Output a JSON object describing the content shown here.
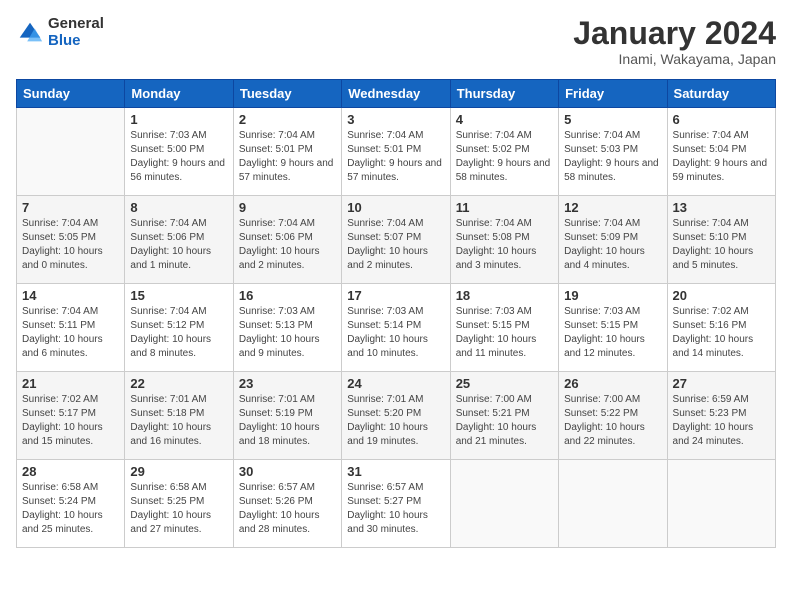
{
  "logo": {
    "general": "General",
    "blue": "Blue"
  },
  "title": "January 2024",
  "subtitle": "Inami, Wakayama, Japan",
  "headers": [
    "Sunday",
    "Monday",
    "Tuesday",
    "Wednesday",
    "Thursday",
    "Friday",
    "Saturday"
  ],
  "weeks": [
    [
      {
        "day": "",
        "sunrise": "",
        "sunset": "",
        "daylight": ""
      },
      {
        "day": "1",
        "sunrise": "Sunrise: 7:03 AM",
        "sunset": "Sunset: 5:00 PM",
        "daylight": "Daylight: 9 hours and 56 minutes."
      },
      {
        "day": "2",
        "sunrise": "Sunrise: 7:04 AM",
        "sunset": "Sunset: 5:01 PM",
        "daylight": "Daylight: 9 hours and 57 minutes."
      },
      {
        "day": "3",
        "sunrise": "Sunrise: 7:04 AM",
        "sunset": "Sunset: 5:01 PM",
        "daylight": "Daylight: 9 hours and 57 minutes."
      },
      {
        "day": "4",
        "sunrise": "Sunrise: 7:04 AM",
        "sunset": "Sunset: 5:02 PM",
        "daylight": "Daylight: 9 hours and 58 minutes."
      },
      {
        "day": "5",
        "sunrise": "Sunrise: 7:04 AM",
        "sunset": "Sunset: 5:03 PM",
        "daylight": "Daylight: 9 hours and 58 minutes."
      },
      {
        "day": "6",
        "sunrise": "Sunrise: 7:04 AM",
        "sunset": "Sunset: 5:04 PM",
        "daylight": "Daylight: 9 hours and 59 minutes."
      }
    ],
    [
      {
        "day": "7",
        "sunrise": "Sunrise: 7:04 AM",
        "sunset": "Sunset: 5:05 PM",
        "daylight": "Daylight: 10 hours and 0 minutes."
      },
      {
        "day": "8",
        "sunrise": "Sunrise: 7:04 AM",
        "sunset": "Sunset: 5:06 PM",
        "daylight": "Daylight: 10 hours and 1 minute."
      },
      {
        "day": "9",
        "sunrise": "Sunrise: 7:04 AM",
        "sunset": "Sunset: 5:06 PM",
        "daylight": "Daylight: 10 hours and 2 minutes."
      },
      {
        "day": "10",
        "sunrise": "Sunrise: 7:04 AM",
        "sunset": "Sunset: 5:07 PM",
        "daylight": "Daylight: 10 hours and 2 minutes."
      },
      {
        "day": "11",
        "sunrise": "Sunrise: 7:04 AM",
        "sunset": "Sunset: 5:08 PM",
        "daylight": "Daylight: 10 hours and 3 minutes."
      },
      {
        "day": "12",
        "sunrise": "Sunrise: 7:04 AM",
        "sunset": "Sunset: 5:09 PM",
        "daylight": "Daylight: 10 hours and 4 minutes."
      },
      {
        "day": "13",
        "sunrise": "Sunrise: 7:04 AM",
        "sunset": "Sunset: 5:10 PM",
        "daylight": "Daylight: 10 hours and 5 minutes."
      }
    ],
    [
      {
        "day": "14",
        "sunrise": "Sunrise: 7:04 AM",
        "sunset": "Sunset: 5:11 PM",
        "daylight": "Daylight: 10 hours and 6 minutes."
      },
      {
        "day": "15",
        "sunrise": "Sunrise: 7:04 AM",
        "sunset": "Sunset: 5:12 PM",
        "daylight": "Daylight: 10 hours and 8 minutes."
      },
      {
        "day": "16",
        "sunrise": "Sunrise: 7:03 AM",
        "sunset": "Sunset: 5:13 PM",
        "daylight": "Daylight: 10 hours and 9 minutes."
      },
      {
        "day": "17",
        "sunrise": "Sunrise: 7:03 AM",
        "sunset": "Sunset: 5:14 PM",
        "daylight": "Daylight: 10 hours and 10 minutes."
      },
      {
        "day": "18",
        "sunrise": "Sunrise: 7:03 AM",
        "sunset": "Sunset: 5:15 PM",
        "daylight": "Daylight: 10 hours and 11 minutes."
      },
      {
        "day": "19",
        "sunrise": "Sunrise: 7:03 AM",
        "sunset": "Sunset: 5:15 PM",
        "daylight": "Daylight: 10 hours and 12 minutes."
      },
      {
        "day": "20",
        "sunrise": "Sunrise: 7:02 AM",
        "sunset": "Sunset: 5:16 PM",
        "daylight": "Daylight: 10 hours and 14 minutes."
      }
    ],
    [
      {
        "day": "21",
        "sunrise": "Sunrise: 7:02 AM",
        "sunset": "Sunset: 5:17 PM",
        "daylight": "Daylight: 10 hours and 15 minutes."
      },
      {
        "day": "22",
        "sunrise": "Sunrise: 7:01 AM",
        "sunset": "Sunset: 5:18 PM",
        "daylight": "Daylight: 10 hours and 16 minutes."
      },
      {
        "day": "23",
        "sunrise": "Sunrise: 7:01 AM",
        "sunset": "Sunset: 5:19 PM",
        "daylight": "Daylight: 10 hours and 18 minutes."
      },
      {
        "day": "24",
        "sunrise": "Sunrise: 7:01 AM",
        "sunset": "Sunset: 5:20 PM",
        "daylight": "Daylight: 10 hours and 19 minutes."
      },
      {
        "day": "25",
        "sunrise": "Sunrise: 7:00 AM",
        "sunset": "Sunset: 5:21 PM",
        "daylight": "Daylight: 10 hours and 21 minutes."
      },
      {
        "day": "26",
        "sunrise": "Sunrise: 7:00 AM",
        "sunset": "Sunset: 5:22 PM",
        "daylight": "Daylight: 10 hours and 22 minutes."
      },
      {
        "day": "27",
        "sunrise": "Sunrise: 6:59 AM",
        "sunset": "Sunset: 5:23 PM",
        "daylight": "Daylight: 10 hours and 24 minutes."
      }
    ],
    [
      {
        "day": "28",
        "sunrise": "Sunrise: 6:58 AM",
        "sunset": "Sunset: 5:24 PM",
        "daylight": "Daylight: 10 hours and 25 minutes."
      },
      {
        "day": "29",
        "sunrise": "Sunrise: 6:58 AM",
        "sunset": "Sunset: 5:25 PM",
        "daylight": "Daylight: 10 hours and 27 minutes."
      },
      {
        "day": "30",
        "sunrise": "Sunrise: 6:57 AM",
        "sunset": "Sunset: 5:26 PM",
        "daylight": "Daylight: 10 hours and 28 minutes."
      },
      {
        "day": "31",
        "sunrise": "Sunrise: 6:57 AM",
        "sunset": "Sunset: 5:27 PM",
        "daylight": "Daylight: 10 hours and 30 minutes."
      },
      {
        "day": "",
        "sunrise": "",
        "sunset": "",
        "daylight": ""
      },
      {
        "day": "",
        "sunrise": "",
        "sunset": "",
        "daylight": ""
      },
      {
        "day": "",
        "sunrise": "",
        "sunset": "",
        "daylight": ""
      }
    ]
  ]
}
